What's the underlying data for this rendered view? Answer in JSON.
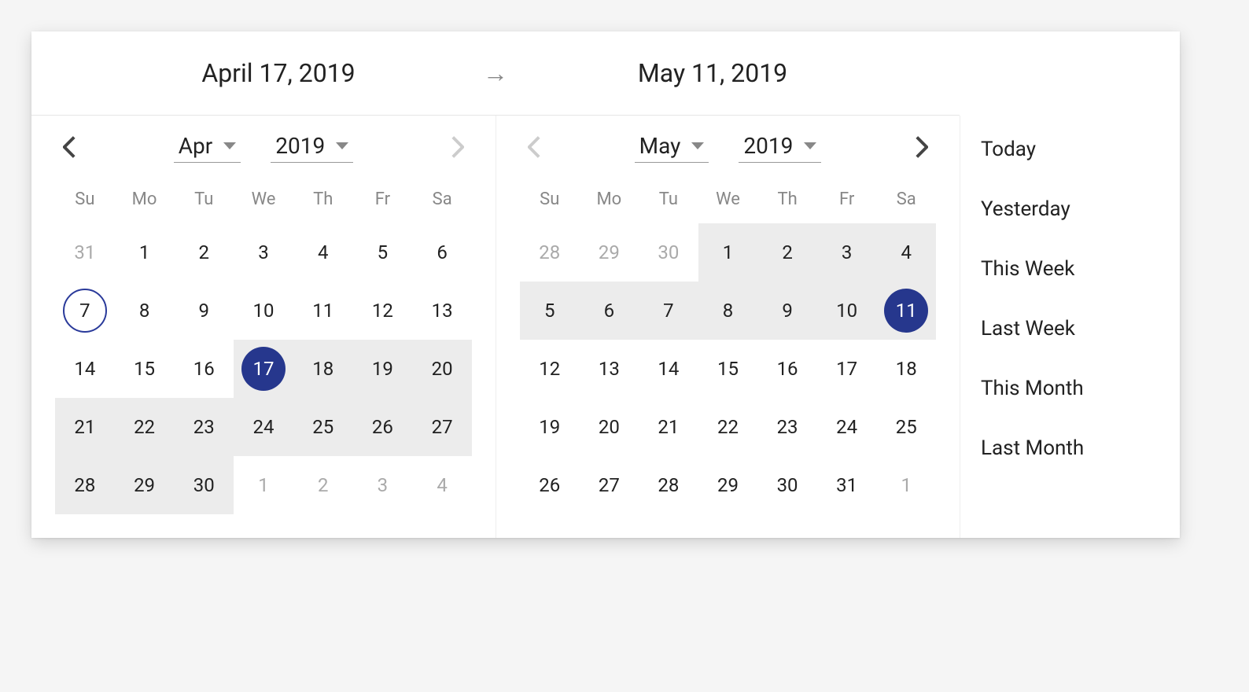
{
  "header": {
    "start_label": "April 17, 2019",
    "end_label": "May 11, 2019"
  },
  "dow": [
    "Su",
    "Mo",
    "Tu",
    "We",
    "Th",
    "Fr",
    "Sa"
  ],
  "left": {
    "month": "Apr",
    "year": "2019",
    "prev_disabled": false,
    "next_disabled": true,
    "days": [
      {
        "n": 31,
        "out": true
      },
      {
        "n": 1
      },
      {
        "n": 2
      },
      {
        "n": 3
      },
      {
        "n": 4
      },
      {
        "n": 5
      },
      {
        "n": 6
      },
      {
        "n": 7,
        "today": true
      },
      {
        "n": 8
      },
      {
        "n": 9
      },
      {
        "n": 10
      },
      {
        "n": 11
      },
      {
        "n": 12
      },
      {
        "n": 13
      },
      {
        "n": 14
      },
      {
        "n": 15
      },
      {
        "n": 16
      },
      {
        "n": 17,
        "selected": true,
        "range": true
      },
      {
        "n": 18,
        "range": true
      },
      {
        "n": 19,
        "range": true
      },
      {
        "n": 20,
        "range": true
      },
      {
        "n": 21,
        "range": true
      },
      {
        "n": 22,
        "range": true
      },
      {
        "n": 23,
        "range": true
      },
      {
        "n": 24,
        "range": true
      },
      {
        "n": 25,
        "range": true
      },
      {
        "n": 26,
        "range": true
      },
      {
        "n": 27,
        "range": true
      },
      {
        "n": 28,
        "range": true
      },
      {
        "n": 29,
        "range": true
      },
      {
        "n": 30,
        "range": true
      },
      {
        "n": 1,
        "out": true
      },
      {
        "n": 2,
        "out": true
      },
      {
        "n": 3,
        "out": true
      },
      {
        "n": 4,
        "out": true
      }
    ]
  },
  "right": {
    "month": "May",
    "year": "2019",
    "prev_disabled": true,
    "next_disabled": false,
    "days": [
      {
        "n": 28,
        "out": true
      },
      {
        "n": 29,
        "out": true
      },
      {
        "n": 30,
        "out": true
      },
      {
        "n": 1,
        "range": true
      },
      {
        "n": 2,
        "range": true
      },
      {
        "n": 3,
        "range": true
      },
      {
        "n": 4,
        "range": true
      },
      {
        "n": 5,
        "range": true
      },
      {
        "n": 6,
        "range": true
      },
      {
        "n": 7,
        "range": true
      },
      {
        "n": 8,
        "range": true
      },
      {
        "n": 9,
        "range": true
      },
      {
        "n": 10,
        "range": true
      },
      {
        "n": 11,
        "selected": true,
        "range": true
      },
      {
        "n": 12
      },
      {
        "n": 13
      },
      {
        "n": 14
      },
      {
        "n": 15
      },
      {
        "n": 16
      },
      {
        "n": 17
      },
      {
        "n": 18
      },
      {
        "n": 19
      },
      {
        "n": 20
      },
      {
        "n": 21
      },
      {
        "n": 22
      },
      {
        "n": 23
      },
      {
        "n": 24
      },
      {
        "n": 25
      },
      {
        "n": 26
      },
      {
        "n": 27
      },
      {
        "n": 28
      },
      {
        "n": 29
      },
      {
        "n": 30
      },
      {
        "n": 31
      },
      {
        "n": 1,
        "out": true
      }
    ]
  },
  "presets": [
    "Today",
    "Yesterday",
    "This Week",
    "Last Week",
    "This Month",
    "Last Month"
  ]
}
